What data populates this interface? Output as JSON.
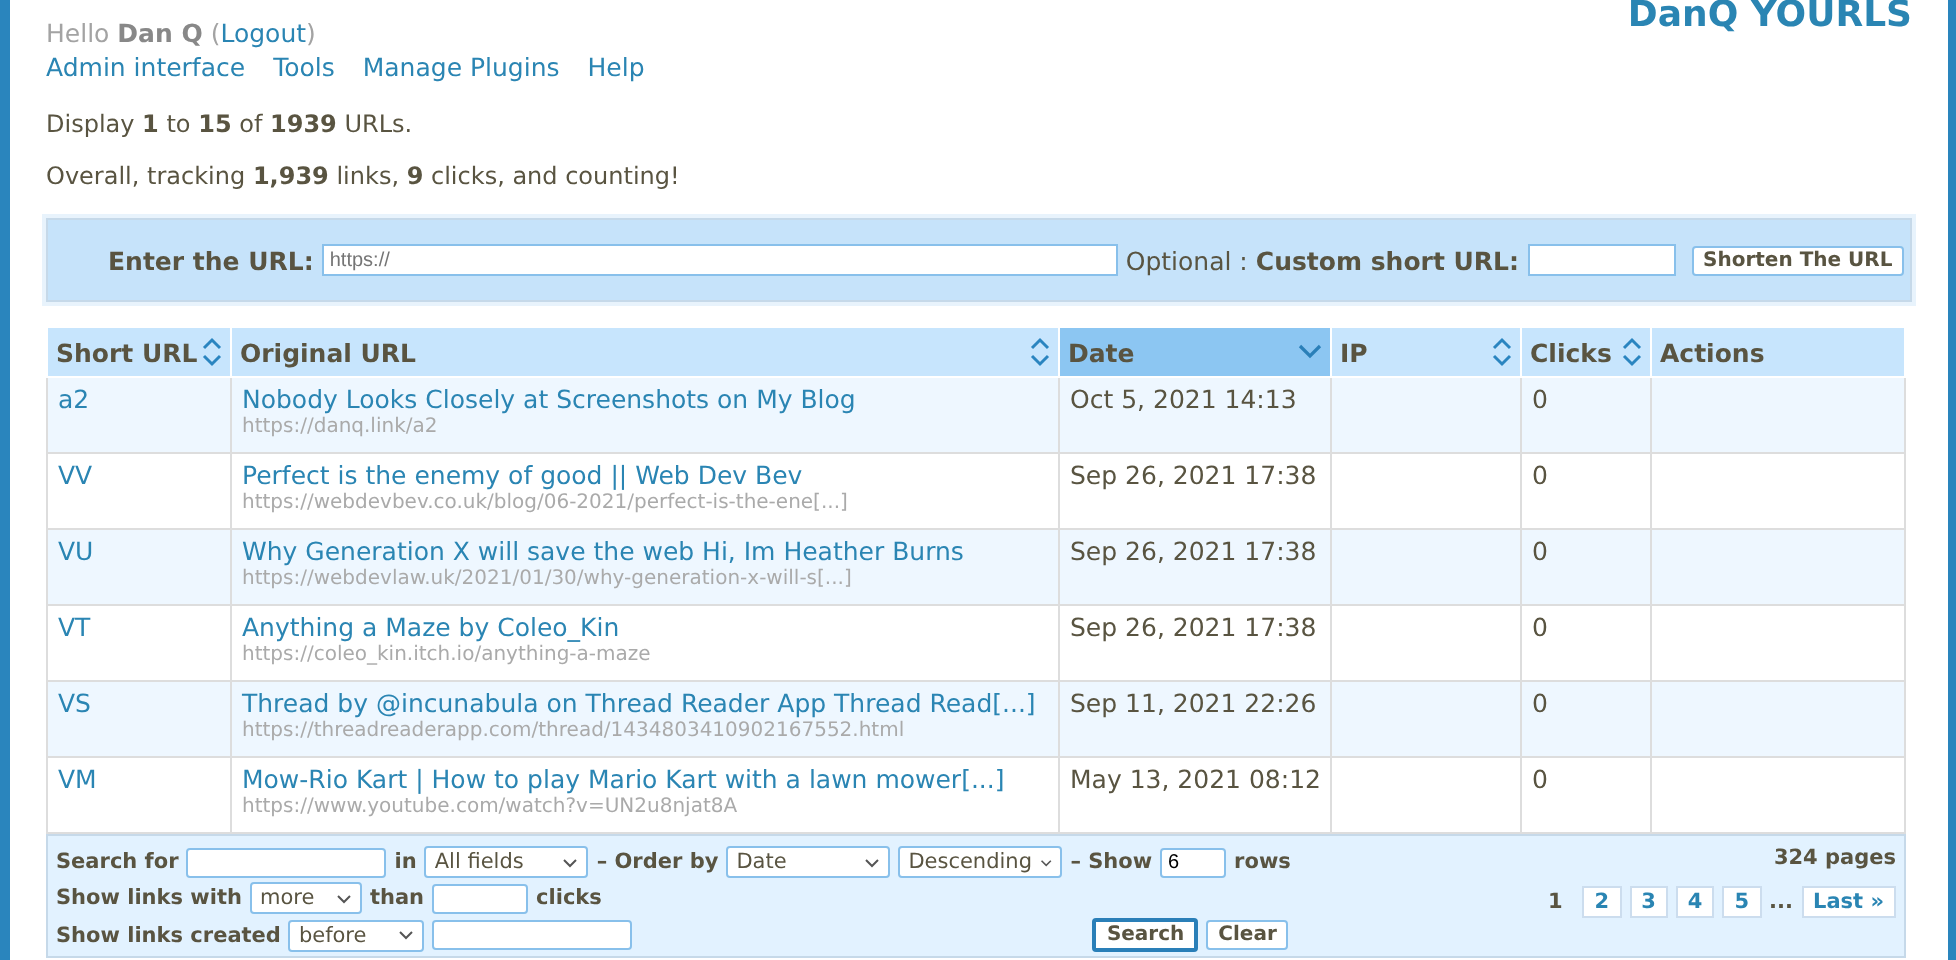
{
  "site_title": "DanQ YOURLS",
  "greeting": {
    "hello": "Hello",
    "user": "Dan Q",
    "open": "(",
    "logout": "Logout",
    "close": ")"
  },
  "nav": [
    "Admin interface",
    "Tools",
    "Manage Plugins",
    "Help"
  ],
  "display_line": "Display **1** to **15** of **1939** URLs.",
  "stats_line": "Overall, tracking **1,939** links, **9** clicks, and counting!",
  "shorten": {
    "url_label": "Enter the URL:",
    "url_placeholder": "https://",
    "optional": "Optional :",
    "custom_label": "Custom short URL:",
    "button": "Shorten The URL"
  },
  "table": {
    "columns": [
      {
        "label": "Short URL",
        "sortable": true,
        "selected": false
      },
      {
        "label": "Original URL",
        "sortable": true,
        "selected": false
      },
      {
        "label": "Date",
        "sortable": true,
        "selected": true
      },
      {
        "label": "IP",
        "sortable": true,
        "selected": false
      },
      {
        "label": "Clicks",
        "sortable": true,
        "selected": false
      },
      {
        "label": "Actions",
        "sortable": false,
        "selected": false
      }
    ],
    "rows": [
      {
        "short": "a2",
        "title": "Nobody Looks Closely at Screenshots on My Blog",
        "url": "https://danq.link/a2",
        "date": "Oct 5, 2021 14:13",
        "clicks": "0"
      },
      {
        "short": "VV",
        "title": "Perfect is the enemy of good || Web Dev Bev",
        "url": "https://webdevbev.co.uk/blog/06-2021/perfect-is-the-ene[...]",
        "date": "Sep 26, 2021 17:38",
        "clicks": "0"
      },
      {
        "short": "VU",
        "title": "Why Generation X will save the web Hi, Im Heather Burns",
        "url": "https://webdevlaw.uk/2021/01/30/why-generation-x-will-s[...]",
        "date": "Sep 26, 2021 17:38",
        "clicks": "0"
      },
      {
        "short": "VT",
        "title": "Anything a Maze by Coleo_Kin",
        "url": "https://coleo_kin.itch.io/anything-a-maze",
        "date": "Sep 26, 2021 17:38",
        "clicks": "0"
      },
      {
        "short": "VS",
        "title": "Thread by @incunabula on Thread Reader App Thread Read[...]",
        "url": "https://threadreaderapp.com/thread/1434803410902167552.html",
        "date": "Sep 11, 2021 22:26",
        "clicks": "0"
      },
      {
        "short": "VM",
        "title": "Mow-Rio Kart | How to play Mario Kart with a lawn mower[...]",
        "url": "https://www.youtube.com/watch?v=UN2u8njat8A",
        "date": "May 13, 2021 08:12",
        "clicks": "0"
      }
    ]
  },
  "filters": {
    "search_for": "Search for",
    "in": "in",
    "field_select": "All fields",
    "order_by": "– Order by",
    "order_select": "Date",
    "direction_select": "Descending",
    "show": "– Show",
    "rows_value": "6",
    "rows": "rows",
    "links_with": "Show links with",
    "compare_select": "more",
    "than": "than",
    "clicks": "clicks",
    "created": "Show links created",
    "when_select": "before",
    "search_button": "Search",
    "clear_button": "Clear"
  },
  "pagination": {
    "count": "324 pages",
    "pages": [
      {
        "label": "1",
        "selected": true
      },
      {
        "label": "2",
        "selected": false
      },
      {
        "label": "3",
        "selected": false
      },
      {
        "label": "4",
        "selected": false
      },
      {
        "label": "5",
        "selected": false
      }
    ],
    "ellipsis": "...",
    "last": "Last »"
  }
}
